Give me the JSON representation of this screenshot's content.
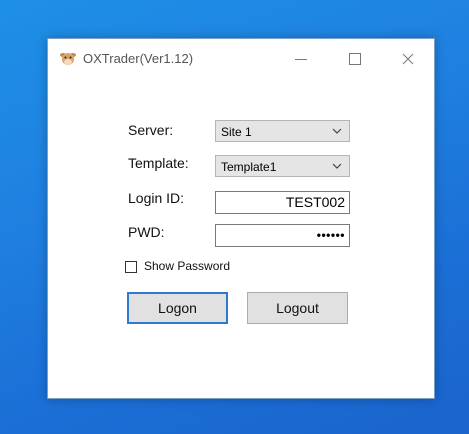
{
  "window": {
    "title": "OXTrader(Ver1.12)",
    "icon": "cow-icon",
    "controls": [
      "minimize-icon",
      "maximize-icon",
      "close-icon"
    ]
  },
  "form": {
    "server_label": "Server:",
    "server_value": "Site 1",
    "template_label": "Template:",
    "template_value": "Template1",
    "login_label": "Login ID:",
    "login_value": "TEST002",
    "pwd_label": "PWD:",
    "pwd_value": "••••••",
    "show_password_label": "Show Password",
    "show_password_checked": false
  },
  "buttons": {
    "logon_label": "Logon",
    "logout_label": "Logout"
  },
  "colors": {
    "desktop_blue": "#1e84e3",
    "focus_border": "#2f79d0",
    "combo_bg": "#e5e5e5"
  }
}
